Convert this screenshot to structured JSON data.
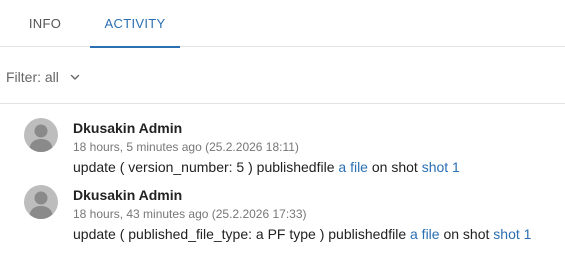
{
  "tabs": [
    {
      "label": "INFO"
    },
    {
      "label": "ACTIVITY"
    }
  ],
  "filter": {
    "label": "Filter: all",
    "icon": "chevron-down-icon"
  },
  "colors": {
    "accent": "#2a6fb2",
    "avatar_bg": "#bdbdbd"
  },
  "entries": [
    {
      "author": "Dkusakin Admin",
      "time": "18 hours, 5 minutes ago (25.2.2026 18:11)",
      "text_before": "update ( version_number: 5 ) publishedfile",
      "link_file": "a file",
      "text_mid": "on shot",
      "link_shot": "shot 1"
    },
    {
      "author": "Dkusakin Admin",
      "time": "18 hours, 43 minutes ago (25.2.2026 17:33)",
      "text_before": "update ( published_file_type: a PF type ) publishedfile",
      "link_file": "a file",
      "text_mid": "on shot",
      "link_shot": "shot 1"
    }
  ]
}
